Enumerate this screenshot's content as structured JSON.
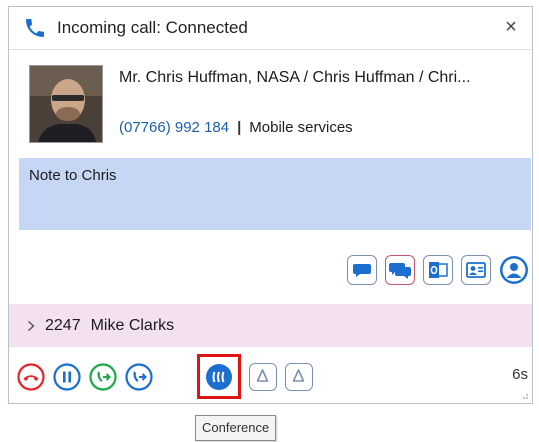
{
  "window": {
    "title": "Incoming call: Connected",
    "close_symbol": "×"
  },
  "contact": {
    "name": "Mr. Chris Huffman, NASA / Chris Huffman / Chri...",
    "phone": "(07766) 992 184",
    "separator": "|",
    "service": "Mobile services"
  },
  "note": {
    "text": "Note to Chris"
  },
  "tools": [
    {
      "icon": "chat-bubble-icon"
    },
    {
      "icon": "conversation-bubbles-icon"
    },
    {
      "icon": "outlook-icon"
    },
    {
      "icon": "contact-card-icon"
    },
    {
      "icon": "user-profile-icon"
    }
  ],
  "held_call": {
    "extension": "2247",
    "name": "Mike Clarks"
  },
  "call_controls": {
    "hangup": {
      "icon": "hangup-icon"
    },
    "hold": {
      "icon": "pause-icon"
    },
    "transfer": {
      "icon": "transfer-icon"
    },
    "consult": {
      "icon": "consult-transfer-icon"
    },
    "conference": {
      "icon": "conference-icon"
    },
    "extra1": {
      "icon": "bell-icon"
    },
    "extra2": {
      "icon": "bell-icon"
    }
  },
  "timer": "6s",
  "tooltip": "Conference",
  "colors": {
    "accent_blue": "#1c6fd1",
    "hangup_red": "#e0262a",
    "transfer_green": "#1ea84a",
    "note_bg": "#c5d7f5",
    "held_bg": "#f3e0f1",
    "highlight_red": "#e11414"
  }
}
